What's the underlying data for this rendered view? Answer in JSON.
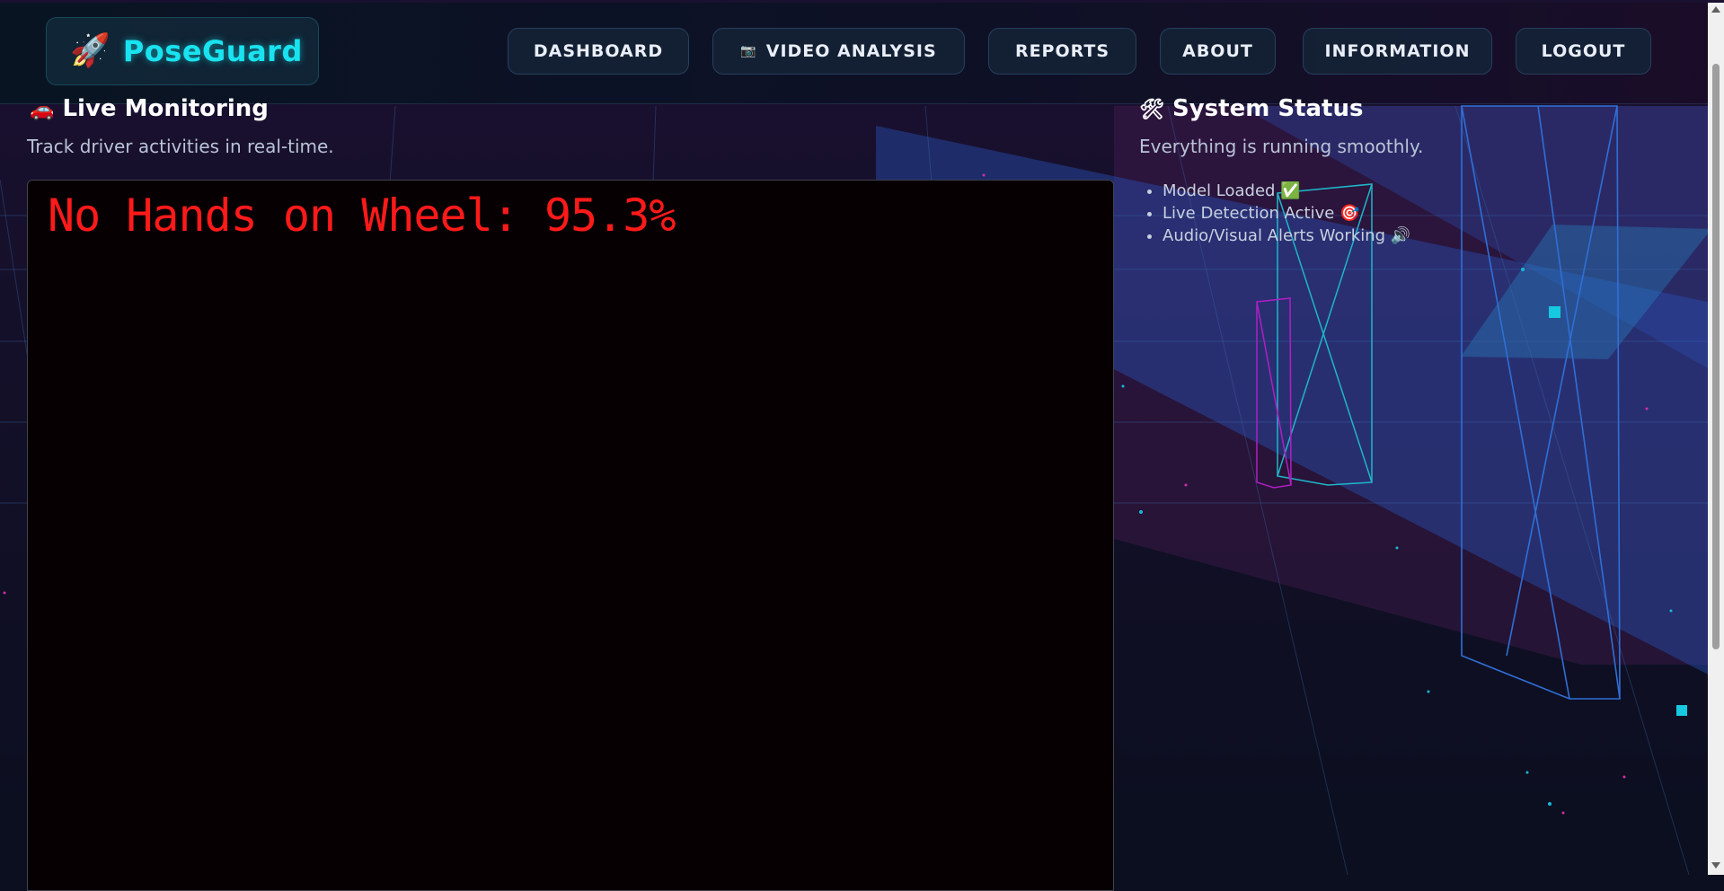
{
  "app": {
    "brand": "PoseGuard",
    "logo_icon": "rocket-icon"
  },
  "nav": {
    "items": [
      {
        "label": "DASHBOARD"
      },
      {
        "label": "VIDEO ANALYSIS",
        "icon": "camera-icon"
      },
      {
        "label": "REPORTS"
      },
      {
        "label": "ABOUT"
      },
      {
        "label": "INFORMATION"
      },
      {
        "label": "LOGOUT"
      }
    ]
  },
  "live": {
    "title": "Live Monitoring",
    "icon": "car-icon",
    "subtitle": "Track driver activities in real-time.",
    "overlay_text": "No Hands on Wheel: 95.3%"
  },
  "system": {
    "title": "System Status",
    "icon": "tools-icon",
    "subtitle": "Everything is running smoothly.",
    "items": [
      {
        "label": "Model Loaded",
        "icon": "check-icon"
      },
      {
        "label": "Live Detection Active",
        "icon": "target-icon"
      },
      {
        "label": "Audio/Visual Alerts Working",
        "icon": "speaker-icon"
      }
    ]
  },
  "colors": {
    "accent_cyan": "#19e3f0",
    "alert_red": "#ff1a1a",
    "background": "#0b0f1f"
  }
}
